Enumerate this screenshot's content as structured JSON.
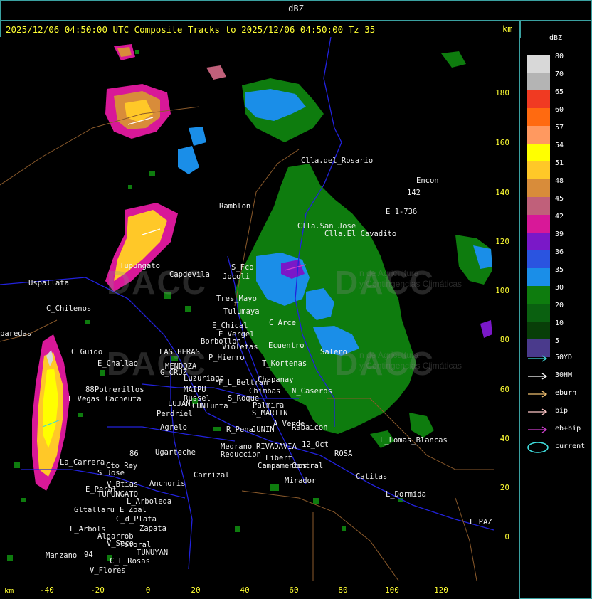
{
  "window": {
    "title": "dBZ"
  },
  "header": {
    "caption": "2025/12/06 04:50:00 UTC Composite Tracks to 2025/12/06 04:50:00 Tz 35",
    "km_label": "km"
  },
  "axes": {
    "x_label": "km",
    "y_label": "km",
    "x_ticks": [
      "-40",
      "-20",
      "0",
      "20",
      "40",
      "60",
      "80",
      "100",
      "120"
    ],
    "y_ticks": [
      "180",
      "160",
      "140",
      "120",
      "100",
      "80",
      "60",
      "40",
      "20",
      "0"
    ]
  },
  "legend": {
    "title": "dBZ",
    "levels": [
      {
        "label": "80",
        "color": "#d8d8d8"
      },
      {
        "label": "70",
        "color": "#b4b4b4"
      },
      {
        "label": "65",
        "color": "#f03a22"
      },
      {
        "label": "60",
        "color": "#ff6a10"
      },
      {
        "label": "57",
        "color": "#ff9960"
      },
      {
        "label": "54",
        "color": "#ffff00"
      },
      {
        "label": "51",
        "color": "#ffc828"
      },
      {
        "label": "48",
        "color": "#d88c3a"
      },
      {
        "label": "45",
        "color": "#c0607a"
      },
      {
        "label": "42",
        "color": "#d81898"
      },
      {
        "label": "39",
        "color": "#7a18c8"
      },
      {
        "label": "36",
        "color": "#2a54e0"
      },
      {
        "label": "35",
        "color": "#1a8ee8"
      },
      {
        "label": "30",
        "color": "#0e7c0e"
      },
      {
        "label": "20",
        "color": "#0a6010"
      },
      {
        "label": "10",
        "color": "#083e08"
      },
      {
        "label": "5",
        "color": "#4a3a8c"
      }
    ],
    "tracks": [
      {
        "label": "50YD",
        "color": "#40d8d8"
      },
      {
        "label": "30HM",
        "color": "#ffffff"
      },
      {
        "label": "eburn",
        "color": "#f0c070"
      },
      {
        "label": "bip",
        "color": "#ffc8c8"
      },
      {
        "label": "eb+bip",
        "color": "#d040d0"
      },
      {
        "label": "current",
        "color": "#40e0e0"
      }
    ]
  },
  "watermark": {
    "logo_text": "DACC",
    "tagline_line1": "n de Agricultura",
    "tagline_line2": "y Contingencias Climáticas"
  },
  "places": [
    {
      "name": "Clla.del_Rosario"
    },
    {
      "name": "Encon"
    },
    {
      "name": "142"
    },
    {
      "name": "E_1-736"
    },
    {
      "name": "Ramblon"
    },
    {
      "name": "Clla.San_Jose"
    },
    {
      "name": "Clla.El_Cavadito"
    },
    {
      "name": "Uspallata"
    },
    {
      "name": "Tupungato"
    },
    {
      "name": "Capdevila"
    },
    {
      "name": "S_Fco"
    },
    {
      "name": "Jocoli"
    },
    {
      "name": "C_Chilenos"
    },
    {
      "name": "Tres_Mayo"
    },
    {
      "name": "Tulumaya"
    },
    {
      "name": "paredas"
    },
    {
      "name": "E_Chical"
    },
    {
      "name": "E_Vergel"
    },
    {
      "name": "Borbollon"
    },
    {
      "name": "Violetas"
    },
    {
      "name": "C_Arce"
    },
    {
      "name": "Ecuentro"
    },
    {
      "name": "Salero"
    },
    {
      "name": "C_Guido"
    },
    {
      "name": "LAS_HERAS"
    },
    {
      "name": "P_Hierro"
    },
    {
      "name": "E_Challao"
    },
    {
      "name": "MENDOZA"
    },
    {
      "name": "T_Kortenas"
    },
    {
      "name": "G_CRUZ"
    },
    {
      "name": "Luzuriaga"
    },
    {
      "name": "Chapanay"
    },
    {
      "name": "F_L_Beltran"
    },
    {
      "name": "Potrerillos"
    },
    {
      "name": "MAIPU"
    },
    {
      "name": "Chimbas"
    },
    {
      "name": "N_Caseros"
    },
    {
      "name": "L_Vegas"
    },
    {
      "name": "Cacheuta"
    },
    {
      "name": "Russel"
    },
    {
      "name": "S_Roque"
    },
    {
      "name": "LUJAN"
    },
    {
      "name": "CUNlunta"
    },
    {
      "name": "Palmira"
    },
    {
      "name": "Perdriel"
    },
    {
      "name": "S_MARTIN"
    },
    {
      "name": "A_Verde"
    },
    {
      "name": "Agrelo"
    },
    {
      "name": "Rabaicon"
    },
    {
      "name": "R_Pena"
    },
    {
      "name": "JUNIN"
    },
    {
      "name": "Ugarteche"
    },
    {
      "name": "Medrano"
    },
    {
      "name": "RIVADAVIA"
    },
    {
      "name": "12_Oct"
    },
    {
      "name": "L_Lomas_Blancas"
    },
    {
      "name": "Reduccion"
    },
    {
      "name": "Libert"
    },
    {
      "name": "ROSA"
    },
    {
      "name": "La_Carrera"
    },
    {
      "name": "Cto_Rey"
    },
    {
      "name": "S_Jose"
    },
    {
      "name": "Carrizal"
    },
    {
      "name": "Campamentos"
    },
    {
      "name": "Central"
    },
    {
      "name": "Catitas"
    },
    {
      "name": "V_Btias"
    },
    {
      "name": "Anchoris"
    },
    {
      "name": "E_Peral"
    },
    {
      "name": "TUPUNGATO"
    },
    {
      "name": "Mirador"
    },
    {
      "name": "L_Dormida"
    },
    {
      "name": "L_Arboleda"
    },
    {
      "name": "Gltallaru"
    },
    {
      "name": "E_Zpal"
    },
    {
      "name": "L_Arbols"
    },
    {
      "name": "C_d_Plata"
    },
    {
      "name": "Zapata"
    },
    {
      "name": "L_PAZ"
    },
    {
      "name": "Algarrob"
    },
    {
      "name": "V_Seco"
    },
    {
      "name": "Totoral"
    },
    {
      "name": "TUNUYAN"
    },
    {
      "name": "Manzano"
    },
    {
      "name": "C_L_Rosas"
    },
    {
      "name": "V_Flores"
    },
    {
      "name": "88"
    },
    {
      "name": "86"
    },
    {
      "name": "94"
    }
  ]
}
